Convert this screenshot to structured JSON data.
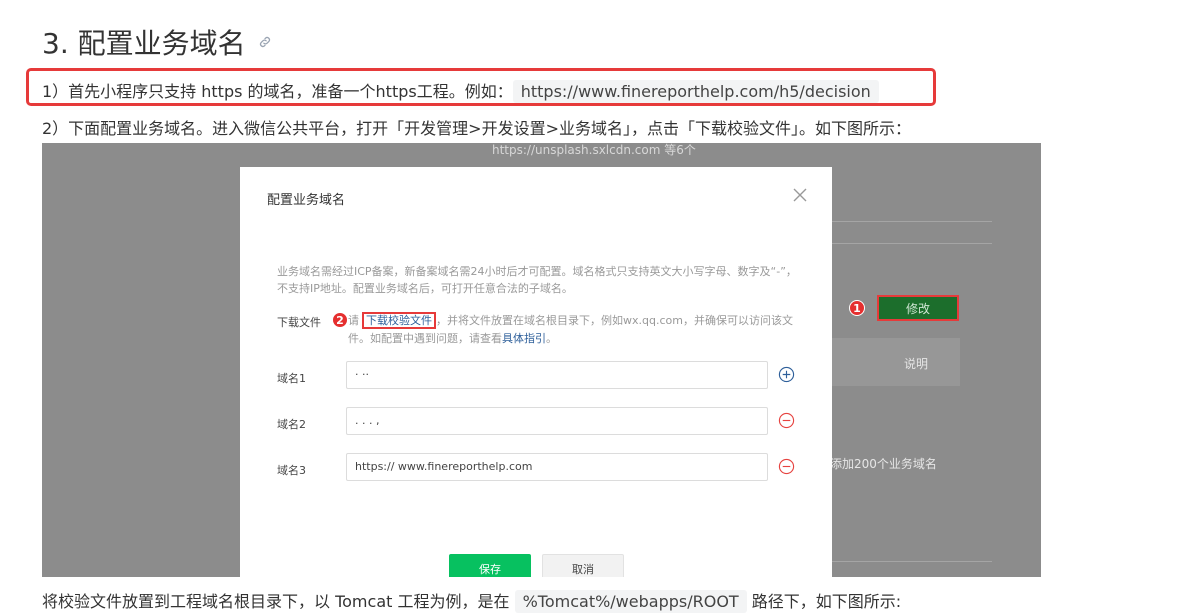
{
  "section": {
    "title": "3. 配置业务域名"
  },
  "step1": {
    "text": "1）首先小程序只支持 https 的域名，准备一个https工程。例如：",
    "code": "https://www.finereporthelp.com/h5/decision"
  },
  "step2": {
    "text": "2）下面配置业务域名。进入微信公共平台，打开「开发管理>开发设置>业务域名」，点击「下载校验文件」。如下图所示："
  },
  "step3": {
    "before": "将校验文件放置到工程域名根目录下，以 Tomcat 工程为例，是在",
    "code": "%Tomcat%/webapps/ROOT",
    "after": " 路径下，如下图所示:"
  },
  "screenshot": {
    "bg_top_text": "https://unsplash.sxlcdn.com 等6个",
    "modify_button": "修改",
    "badge1": "1",
    "bg_column_header": "说明",
    "bg_right_text": "添加200个业务域名",
    "modal": {
      "title": "配置业务域名",
      "notice": "业务域名需经过ICP备案，新备案域名需24小时后才可配置。域名格式只支持英文大小写字母、数字及“-”，不支持IP地址。配置业务域名后，可打开任意合法的子域名。",
      "download_label": "下载文件",
      "badge2": "2",
      "download_prefix": "请",
      "download_link": "下载校验文件",
      "download_suffix": "，并将文件放置在域名根目录下，例如wx.qq.com，并确保可以访问该文",
      "download_line2_prefix": "件。如配置中遇到问题，请查看",
      "guide_link": "具体指引",
      "download_line2_suffix": "。",
      "fields": [
        {
          "label": "域名1",
          "value": "·        ··"
        },
        {
          "label": "域名2",
          "value": "      .    . .  ,"
        },
        {
          "label": "域名3",
          "value": "https:// www.finereporthelp.com"
        }
      ],
      "save_button": "保存",
      "cancel_button": "取消"
    }
  },
  "colors": {
    "highlight_border": "#e63a3a",
    "save_green": "#07c160",
    "modify_green": "#1c6e2c",
    "link_blue": "#2e5f9a"
  }
}
